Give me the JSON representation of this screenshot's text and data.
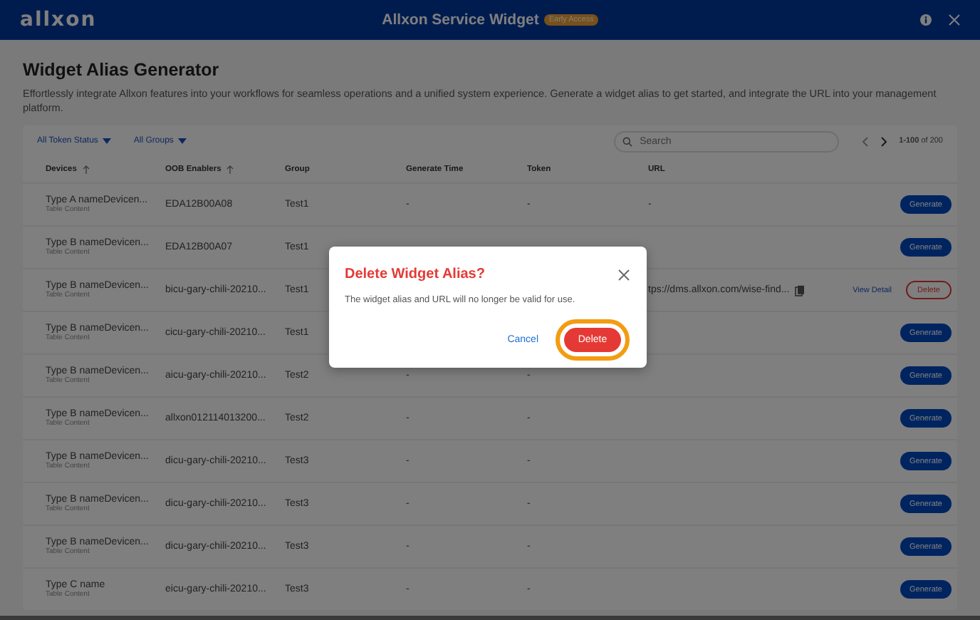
{
  "header": {
    "logo": "allxon",
    "title": "Allxon Service Widget",
    "badge": "Early Access"
  },
  "page": {
    "title": "Widget Alias Generator",
    "description": "Effortlessly integrate Allxon features into your workflows for seamless operations and a unified system experience. Generate a widget alias to get started, and integrate the URL into your management platform."
  },
  "filters": [
    "All Token Status",
    "All Groups"
  ],
  "search": {
    "placeholder": "Search"
  },
  "pagination": {
    "range": "1-100",
    "total": "of 200"
  },
  "table": {
    "columns": [
      {
        "label": "Devices",
        "sortable": true
      },
      {
        "label": "OOB Enablers",
        "sortable": true
      },
      {
        "label": "Group",
        "sortable": false
      },
      {
        "label": "Generate Time",
        "sortable": false
      },
      {
        "label": "Token",
        "sortable": false
      },
      {
        "label": "URL",
        "sortable": false
      }
    ],
    "rows": [
      {
        "device": "Type A nameDevicen...",
        "sub": "Table Content",
        "oob": "EDA12B00A08",
        "group": "Test1",
        "time": "-",
        "token": "-",
        "url": "-",
        "action": {
          "kind": "generate",
          "label": "Generate"
        }
      },
      {
        "device": "Type B nameDevicen...",
        "sub": "Table Content",
        "oob": "EDA12B00A07",
        "group": "Test1",
        "action": {
          "kind": "generate",
          "label": "Generate"
        }
      },
      {
        "device": "Type B nameDevicen...",
        "sub": "Table Content",
        "oob": "bicu-gary-chili-20210...",
        "group": "Test1",
        "url": "tps://dms.allxon.com/wise-find...",
        "copyable": true,
        "view_detail": "View Detail",
        "action": {
          "kind": "delete",
          "label": "Delete"
        }
      },
      {
        "device": "Type B nameDevicen...",
        "sub": "Table Content",
        "oob": "cicu-gary-chili-20210...",
        "group": "Test1",
        "action": {
          "kind": "generate",
          "label": "Generate"
        }
      },
      {
        "device": "Type B nameDevicen...",
        "sub": "Table Content",
        "oob": "aicu-gary-chili-20210...",
        "group": "Test2",
        "time": "-",
        "token": "-",
        "action": {
          "kind": "generate",
          "label": "Generate"
        }
      },
      {
        "device": "Type B nameDevicen...",
        "sub": "Table Content",
        "oob": "allxon012114013200...",
        "group": "Test2",
        "time": "-",
        "token": "-",
        "action": {
          "kind": "generate",
          "label": "Generate"
        }
      },
      {
        "device": "Type B nameDevicen...",
        "sub": "Table Content",
        "oob": "dicu-gary-chili-20210...",
        "group": "Test3",
        "time": "-",
        "token": "-",
        "action": {
          "kind": "generate",
          "label": "Generate"
        }
      },
      {
        "device": "Type B nameDevicen...",
        "sub": "Table Content",
        "oob": "dicu-gary-chili-20210...",
        "group": "Test3",
        "time": "-",
        "token": "-",
        "action": {
          "kind": "generate",
          "label": "Generate"
        }
      },
      {
        "device": "Type B nameDevicen...",
        "sub": "Table Content",
        "oob": "dicu-gary-chili-20210...",
        "group": "Test3",
        "time": "-",
        "token": "-",
        "action": {
          "kind": "generate",
          "label": "Generate"
        }
      },
      {
        "device": "Type C name",
        "sub": "Table Content",
        "oob": "eicu-gary-chili-20210...",
        "group": "Test3",
        "time": "-",
        "token": "-",
        "action": {
          "kind": "generate",
          "label": "Generate"
        }
      }
    ]
  },
  "dialog": {
    "title": "Delete Widget Alias?",
    "message": "The widget alias and URL will no longer be valid for use.",
    "cancel": "Cancel",
    "confirm": "Delete",
    "confirm_highlighted": true
  }
}
